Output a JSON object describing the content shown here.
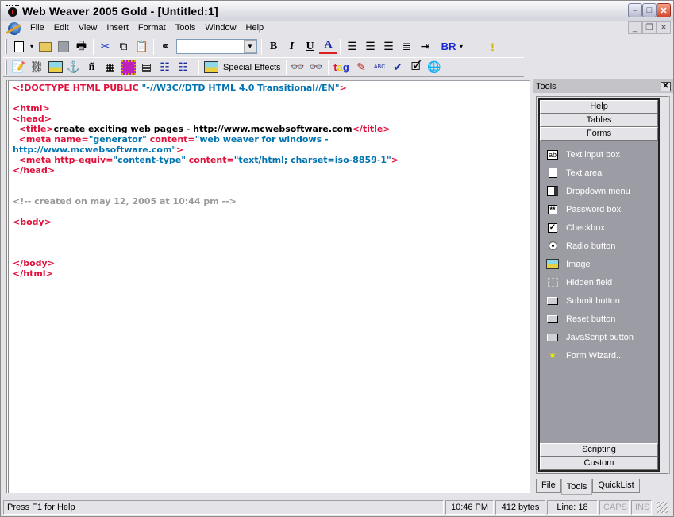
{
  "window": {
    "title": "Web Weaver 2005 Gold - [Untitled:1]",
    "controls": {
      "minimize": "–",
      "maximize": "□",
      "close": "✕"
    },
    "mdi_controls": {
      "minimize": "_",
      "restore": "❐",
      "close": "✕"
    }
  },
  "menu": [
    "File",
    "Edit",
    "View",
    "Insert",
    "Format",
    "Tools",
    "Window",
    "Help"
  ],
  "toolbar1": {
    "find_combo_value": "",
    "bold": "B",
    "italic": "I",
    "underline": "U",
    "font_color": "A",
    "br": "BR",
    "hr": "—",
    "exclaim": "!"
  },
  "toolbar2": {
    "special_effects": "Special Effects",
    "tag": "tag",
    "spell": "ABC"
  },
  "editor": {
    "lines": [
      [
        {
          "t": "t",
          "s": "<!DOCTYPE HTML PUBLIC "
        },
        {
          "t": "v",
          "s": "\"-//W3C//DTD HTML 4.0 Transitional//EN\""
        },
        {
          "t": "t",
          "s": ">"
        }
      ],
      [],
      [
        {
          "t": "t",
          "s": "<html>"
        }
      ],
      [
        {
          "t": "t",
          "s": "<head>"
        }
      ],
      [
        {
          "t": "t",
          "s": "  <title>"
        },
        {
          "t": "k",
          "s": "create exciting web pages - http://www.mcwebsoftware.com"
        },
        {
          "t": "t",
          "s": "</title>"
        }
      ],
      [
        {
          "t": "t",
          "s": "  <meta name="
        },
        {
          "t": "v",
          "s": "\"generator\""
        },
        {
          "t": "t",
          "s": " content="
        },
        {
          "t": "v",
          "s": "\"web weaver for windows -"
        }
      ],
      [
        {
          "t": "v",
          "s": "http://www.mcwebsoftware.com\""
        },
        {
          "t": "t",
          "s": ">"
        }
      ],
      [
        {
          "t": "t",
          "s": "  <meta http-equiv="
        },
        {
          "t": "v",
          "s": "\"content-type\""
        },
        {
          "t": "t",
          "s": " content="
        },
        {
          "t": "v",
          "s": "\"text/html; charset=iso-8859-1\""
        },
        {
          "t": "t",
          "s": ">"
        }
      ],
      [
        {
          "t": "t",
          "s": "</head>"
        }
      ],
      [],
      [],
      [
        {
          "t": "c",
          "s": "<!-- created on may 12, 2005 at 10:44 pm -->"
        }
      ],
      [],
      [
        {
          "t": "t",
          "s": "<body>"
        }
      ],
      [
        {
          "t": "caret",
          "s": ""
        }
      ],
      [],
      [],
      [
        {
          "t": "t",
          "s": "</body>"
        }
      ],
      [
        {
          "t": "t",
          "s": "</html>"
        }
      ]
    ]
  },
  "tools_panel": {
    "title": "Tools",
    "close": "✕",
    "categories_top": [
      "Help",
      "Tables",
      "Forms"
    ],
    "items": [
      {
        "label": "Text input box",
        "icon": "text-input-icon"
      },
      {
        "label": "Text area",
        "icon": "text-area-icon"
      },
      {
        "label": "Dropdown menu",
        "icon": "dropdown-icon"
      },
      {
        "label": "Password box",
        "icon": "password-icon"
      },
      {
        "label": "Checkbox",
        "icon": "checkbox-icon"
      },
      {
        "label": "Radio button",
        "icon": "radio-icon"
      },
      {
        "label": "Image",
        "icon": "image-icon"
      },
      {
        "label": "Hidden field",
        "icon": "hidden-field-icon"
      },
      {
        "label": "Submit button",
        "icon": "button-icon"
      },
      {
        "label": "Reset button",
        "icon": "button-icon"
      },
      {
        "label": "JavaScript button",
        "icon": "button-icon"
      },
      {
        "label": "Form Wizard...",
        "icon": "wand-icon"
      }
    ],
    "categories_bottom": [
      "Scripting",
      "Custom"
    ],
    "tabs": [
      "File",
      "Tools",
      "QuickList"
    ],
    "active_tab": "Tools"
  },
  "status": {
    "help": "Press F1 for Help",
    "time": "10:46 PM",
    "size": "412 bytes",
    "line": "Line: 18",
    "caps": "CAPS",
    "ins": "INS"
  }
}
